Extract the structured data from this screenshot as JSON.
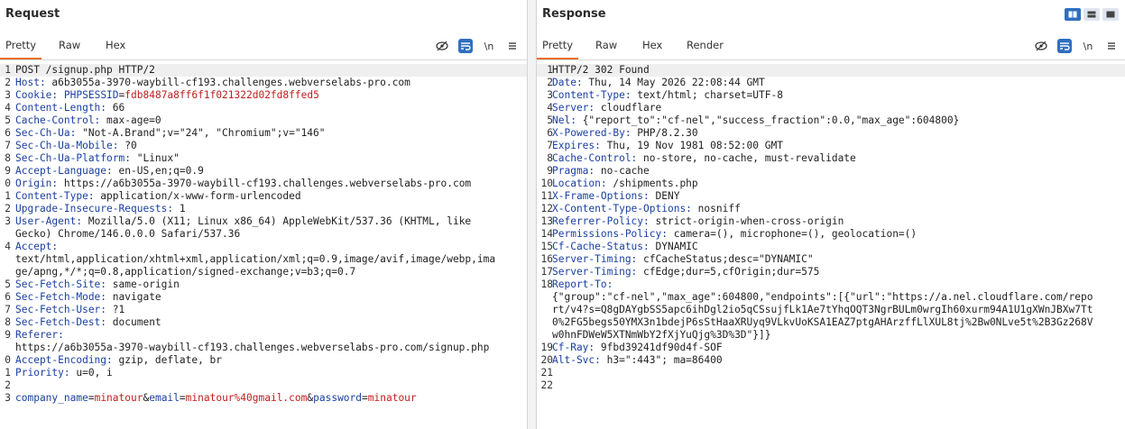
{
  "request": {
    "title": "Request",
    "tabs": [
      "Pretty",
      "Raw",
      "Hex"
    ],
    "lines": [
      {
        "n": "1",
        "parts": [
          {
            "t": "POST /signup.php HTTP/2",
            "c": ""
          }
        ]
      },
      {
        "n": "2",
        "parts": [
          {
            "t": "Host:",
            "c": "hn"
          },
          {
            "t": " a6b3055a-3970-waybill-cf193.challenges.webverselabs-pro.com",
            "c": ""
          }
        ]
      },
      {
        "n": "3",
        "parts": [
          {
            "t": "Cookie:",
            "c": "hn"
          },
          {
            "t": " ",
            "c": ""
          },
          {
            "t": "PHPSESSID",
            "c": "blue"
          },
          {
            "t": "=",
            "c": ""
          },
          {
            "t": "fdb8487a8ff6f1f021322d02fd8ffed5",
            "c": "red"
          }
        ]
      },
      {
        "n": "4",
        "parts": [
          {
            "t": "Content-Length:",
            "c": "hn"
          },
          {
            "t": " 66",
            "c": ""
          }
        ]
      },
      {
        "n": "5",
        "parts": [
          {
            "t": "Cache-Control:",
            "c": "hn"
          },
          {
            "t": " max-age=0",
            "c": ""
          }
        ]
      },
      {
        "n": "6",
        "parts": [
          {
            "t": "Sec-Ch-Ua:",
            "c": "hn"
          },
          {
            "t": " \"Not-A.Brand\";v=\"24\", \"Chromium\";v=\"146\"",
            "c": ""
          }
        ]
      },
      {
        "n": "7",
        "parts": [
          {
            "t": "Sec-Ch-Ua-Mobile:",
            "c": "hn"
          },
          {
            "t": " ?0",
            "c": ""
          }
        ]
      },
      {
        "n": "8",
        "parts": [
          {
            "t": "Sec-Ch-Ua-Platform:",
            "c": "hn"
          },
          {
            "t": " \"Linux\"",
            "c": ""
          }
        ]
      },
      {
        "n": "9",
        "parts": [
          {
            "t": "Accept-Language:",
            "c": "hn"
          },
          {
            "t": " en-US,en;q=0.9",
            "c": ""
          }
        ]
      },
      {
        "n": "0",
        "parts": [
          {
            "t": "Origin:",
            "c": "hn"
          },
          {
            "t": " https://a6b3055a-3970-waybill-cf193.challenges.webverselabs-pro.com",
            "c": ""
          }
        ]
      },
      {
        "n": "1",
        "parts": [
          {
            "t": "Content-Type:",
            "c": "hn"
          },
          {
            "t": " application/x-www-form-urlencoded",
            "c": ""
          }
        ]
      },
      {
        "n": "2",
        "parts": [
          {
            "t": "Upgrade-Insecure-Requests:",
            "c": "hn"
          },
          {
            "t": " 1",
            "c": ""
          }
        ]
      },
      {
        "n": "3",
        "parts": [
          {
            "t": "User-Agent:",
            "c": "hn"
          },
          {
            "t": " Mozilla/5.0 (X11; Linux x86_64) AppleWebKit/537.36 (KHTML, like",
            "c": ""
          }
        ]
      },
      {
        "n": "",
        "parts": [
          {
            "t": "Gecko) Chrome/146.0.0.0 Safari/537.36",
            "c": ""
          }
        ]
      },
      {
        "n": "4",
        "parts": [
          {
            "t": "Accept:",
            "c": "hn"
          }
        ]
      },
      {
        "n": "",
        "parts": [
          {
            "t": "text/html,application/xhtml+xml,application/xml;q=0.9,image/avif,image/webp,ima",
            "c": ""
          }
        ]
      },
      {
        "n": "",
        "parts": [
          {
            "t": "ge/apng,*/*;q=0.8,application/signed-exchange;v=b3;q=0.7",
            "c": ""
          }
        ]
      },
      {
        "n": "5",
        "parts": [
          {
            "t": "Sec-Fetch-Site:",
            "c": "hn"
          },
          {
            "t": " same-origin",
            "c": ""
          }
        ]
      },
      {
        "n": "6",
        "parts": [
          {
            "t": "Sec-Fetch-Mode:",
            "c": "hn"
          },
          {
            "t": " navigate",
            "c": ""
          }
        ]
      },
      {
        "n": "7",
        "parts": [
          {
            "t": "Sec-Fetch-User:",
            "c": "hn"
          },
          {
            "t": " ?1",
            "c": ""
          }
        ]
      },
      {
        "n": "8",
        "parts": [
          {
            "t": "Sec-Fetch-Dest:",
            "c": "hn"
          },
          {
            "t": " document",
            "c": ""
          }
        ]
      },
      {
        "n": "9",
        "parts": [
          {
            "t": "Referer:",
            "c": "hn"
          }
        ]
      },
      {
        "n": "",
        "parts": [
          {
            "t": "https://a6b3055a-3970-waybill-cf193.challenges.webverselabs-pro.com/signup.php",
            "c": ""
          }
        ]
      },
      {
        "n": "0",
        "parts": [
          {
            "t": "Accept-Encoding:",
            "c": "hn"
          },
          {
            "t": " gzip, deflate, br",
            "c": ""
          }
        ]
      },
      {
        "n": "1",
        "parts": [
          {
            "t": "Priority:",
            "c": "hn"
          },
          {
            "t": " u=0, i",
            "c": ""
          }
        ]
      },
      {
        "n": "2",
        "parts": []
      },
      {
        "n": "3",
        "parts": [
          {
            "t": "company_name",
            "c": "blue"
          },
          {
            "t": "=",
            "c": ""
          },
          {
            "t": "minatour",
            "c": "red"
          },
          {
            "t": "&",
            "c": ""
          },
          {
            "t": "email",
            "c": "blue"
          },
          {
            "t": "=",
            "c": ""
          },
          {
            "t": "minatour%40gmail.com",
            "c": "red"
          },
          {
            "t": "&",
            "c": ""
          },
          {
            "t": "password",
            "c": "blue"
          },
          {
            "t": "=",
            "c": ""
          },
          {
            "t": "minatour",
            "c": "red"
          }
        ]
      }
    ]
  },
  "response": {
    "title": "Response",
    "tabs": [
      "Pretty",
      "Raw",
      "Hex",
      "Render"
    ],
    "lines": [
      {
        "n": "1",
        "parts": [
          {
            "t": "HTTP/2 302 Found",
            "c": ""
          }
        ]
      },
      {
        "n": "2",
        "parts": [
          {
            "t": "Date:",
            "c": "hn"
          },
          {
            "t": " Thu, 14 May 2026 22:08:44 GMT",
            "c": ""
          }
        ]
      },
      {
        "n": "3",
        "parts": [
          {
            "t": "Content-Type:",
            "c": "hn"
          },
          {
            "t": " text/html; charset=UTF-8",
            "c": ""
          }
        ]
      },
      {
        "n": "4",
        "parts": [
          {
            "t": "Server:",
            "c": "hn"
          },
          {
            "t": " cloudflare",
            "c": ""
          }
        ]
      },
      {
        "n": "5",
        "parts": [
          {
            "t": "Nel:",
            "c": "hn"
          },
          {
            "t": " {\"report_to\":\"cf-nel\",\"success_fraction\":0.0,\"max_age\":604800}",
            "c": ""
          }
        ]
      },
      {
        "n": "6",
        "parts": [
          {
            "t": "X-Powered-By:",
            "c": "hn"
          },
          {
            "t": " PHP/8.2.30",
            "c": ""
          }
        ]
      },
      {
        "n": "7",
        "parts": [
          {
            "t": "Expires:",
            "c": "hn"
          },
          {
            "t": " Thu, 19 Nov 1981 08:52:00 GMT",
            "c": ""
          }
        ]
      },
      {
        "n": "8",
        "parts": [
          {
            "t": "Cache-Control:",
            "c": "hn"
          },
          {
            "t": " no-store, no-cache, must-revalidate",
            "c": ""
          }
        ]
      },
      {
        "n": "9",
        "parts": [
          {
            "t": "Pragma:",
            "c": "hn"
          },
          {
            "t": " no-cache",
            "c": ""
          }
        ]
      },
      {
        "n": "10",
        "parts": [
          {
            "t": "Location:",
            "c": "hn"
          },
          {
            "t": " /shipments.php",
            "c": ""
          }
        ]
      },
      {
        "n": "11",
        "parts": [
          {
            "t": "X-Frame-Options:",
            "c": "hn"
          },
          {
            "t": " DENY",
            "c": ""
          }
        ]
      },
      {
        "n": "12",
        "parts": [
          {
            "t": "X-Content-Type-Options:",
            "c": "hn"
          },
          {
            "t": " nosniff",
            "c": ""
          }
        ]
      },
      {
        "n": "13",
        "parts": [
          {
            "t": "Referrer-Policy:",
            "c": "hn"
          },
          {
            "t": " strict-origin-when-cross-origin",
            "c": ""
          }
        ]
      },
      {
        "n": "14",
        "parts": [
          {
            "t": "Permissions-Policy:",
            "c": "hn"
          },
          {
            "t": " camera=(), microphone=(), geolocation=()",
            "c": ""
          }
        ]
      },
      {
        "n": "15",
        "parts": [
          {
            "t": "Cf-Cache-Status:",
            "c": "hn"
          },
          {
            "t": " DYNAMIC",
            "c": ""
          }
        ]
      },
      {
        "n": "16",
        "parts": [
          {
            "t": "Server-Timing:",
            "c": "hn"
          },
          {
            "t": " cfCacheStatus;desc=\"DYNAMIC\"",
            "c": ""
          }
        ]
      },
      {
        "n": "17",
        "parts": [
          {
            "t": "Server-Timing:",
            "c": "hn"
          },
          {
            "t": " cfEdge;dur=5,cfOrigin;dur=575",
            "c": ""
          }
        ]
      },
      {
        "n": "18",
        "parts": [
          {
            "t": "Report-To:",
            "c": "hn"
          }
        ]
      },
      {
        "n": "",
        "parts": [
          {
            "t": "{\"group\":\"cf-nel\",\"max_age\":604800,\"endpoints\":[{\"url\":\"https://a.nel.cloudflare.com/repo",
            "c": ""
          }
        ]
      },
      {
        "n": "",
        "parts": [
          {
            "t": "rt/v4?s=Q8gDAYgbSS5apc6ihDgl2io5qCSsujfLk1Ae7tYhqOQT3NgrBULm0wrgIh60xurm94A1U1gXWnJBXw7Tt",
            "c": ""
          }
        ]
      },
      {
        "n": "",
        "parts": [
          {
            "t": "0%2FG5begs50YMX3n1bdejP6sStHaaXRUyq9VLkvUoKSA1EAZ7ptgAHArzffLlXUL8tj%2Bw0NLve5t%2B3Gz268V",
            "c": ""
          }
        ]
      },
      {
        "n": "",
        "parts": [
          {
            "t": "w0hnFDWeW5XTNmWbY2fXjYuQjg%3D%3D\"}]}",
            "c": ""
          }
        ]
      },
      {
        "n": "19",
        "parts": [
          {
            "t": "Cf-Ray:",
            "c": "hn"
          },
          {
            "t": " 9fbd39241df90d4f-SOF",
            "c": ""
          }
        ]
      },
      {
        "n": "20",
        "parts": [
          {
            "t": "Alt-Svc:",
            "c": "hn"
          },
          {
            "t": " h3=\":443\"; ma=86400",
            "c": ""
          }
        ]
      },
      {
        "n": "21",
        "parts": []
      },
      {
        "n": "22",
        "parts": []
      }
    ]
  },
  "toolbar_icons": [
    "eye-slash-icon",
    "wrap-icon",
    "newline-icon",
    "menu-icon"
  ],
  "newline_label": "\\n",
  "view_buttons": [
    "split-horizontal-icon",
    "split-vertical-icon",
    "single-pane-icon"
  ],
  "colors": {
    "accent": "#e8702a",
    "header_name": "#1a3fa0",
    "value_red": "#c31c1c",
    "toggle_blue": "#2f6fbf"
  }
}
